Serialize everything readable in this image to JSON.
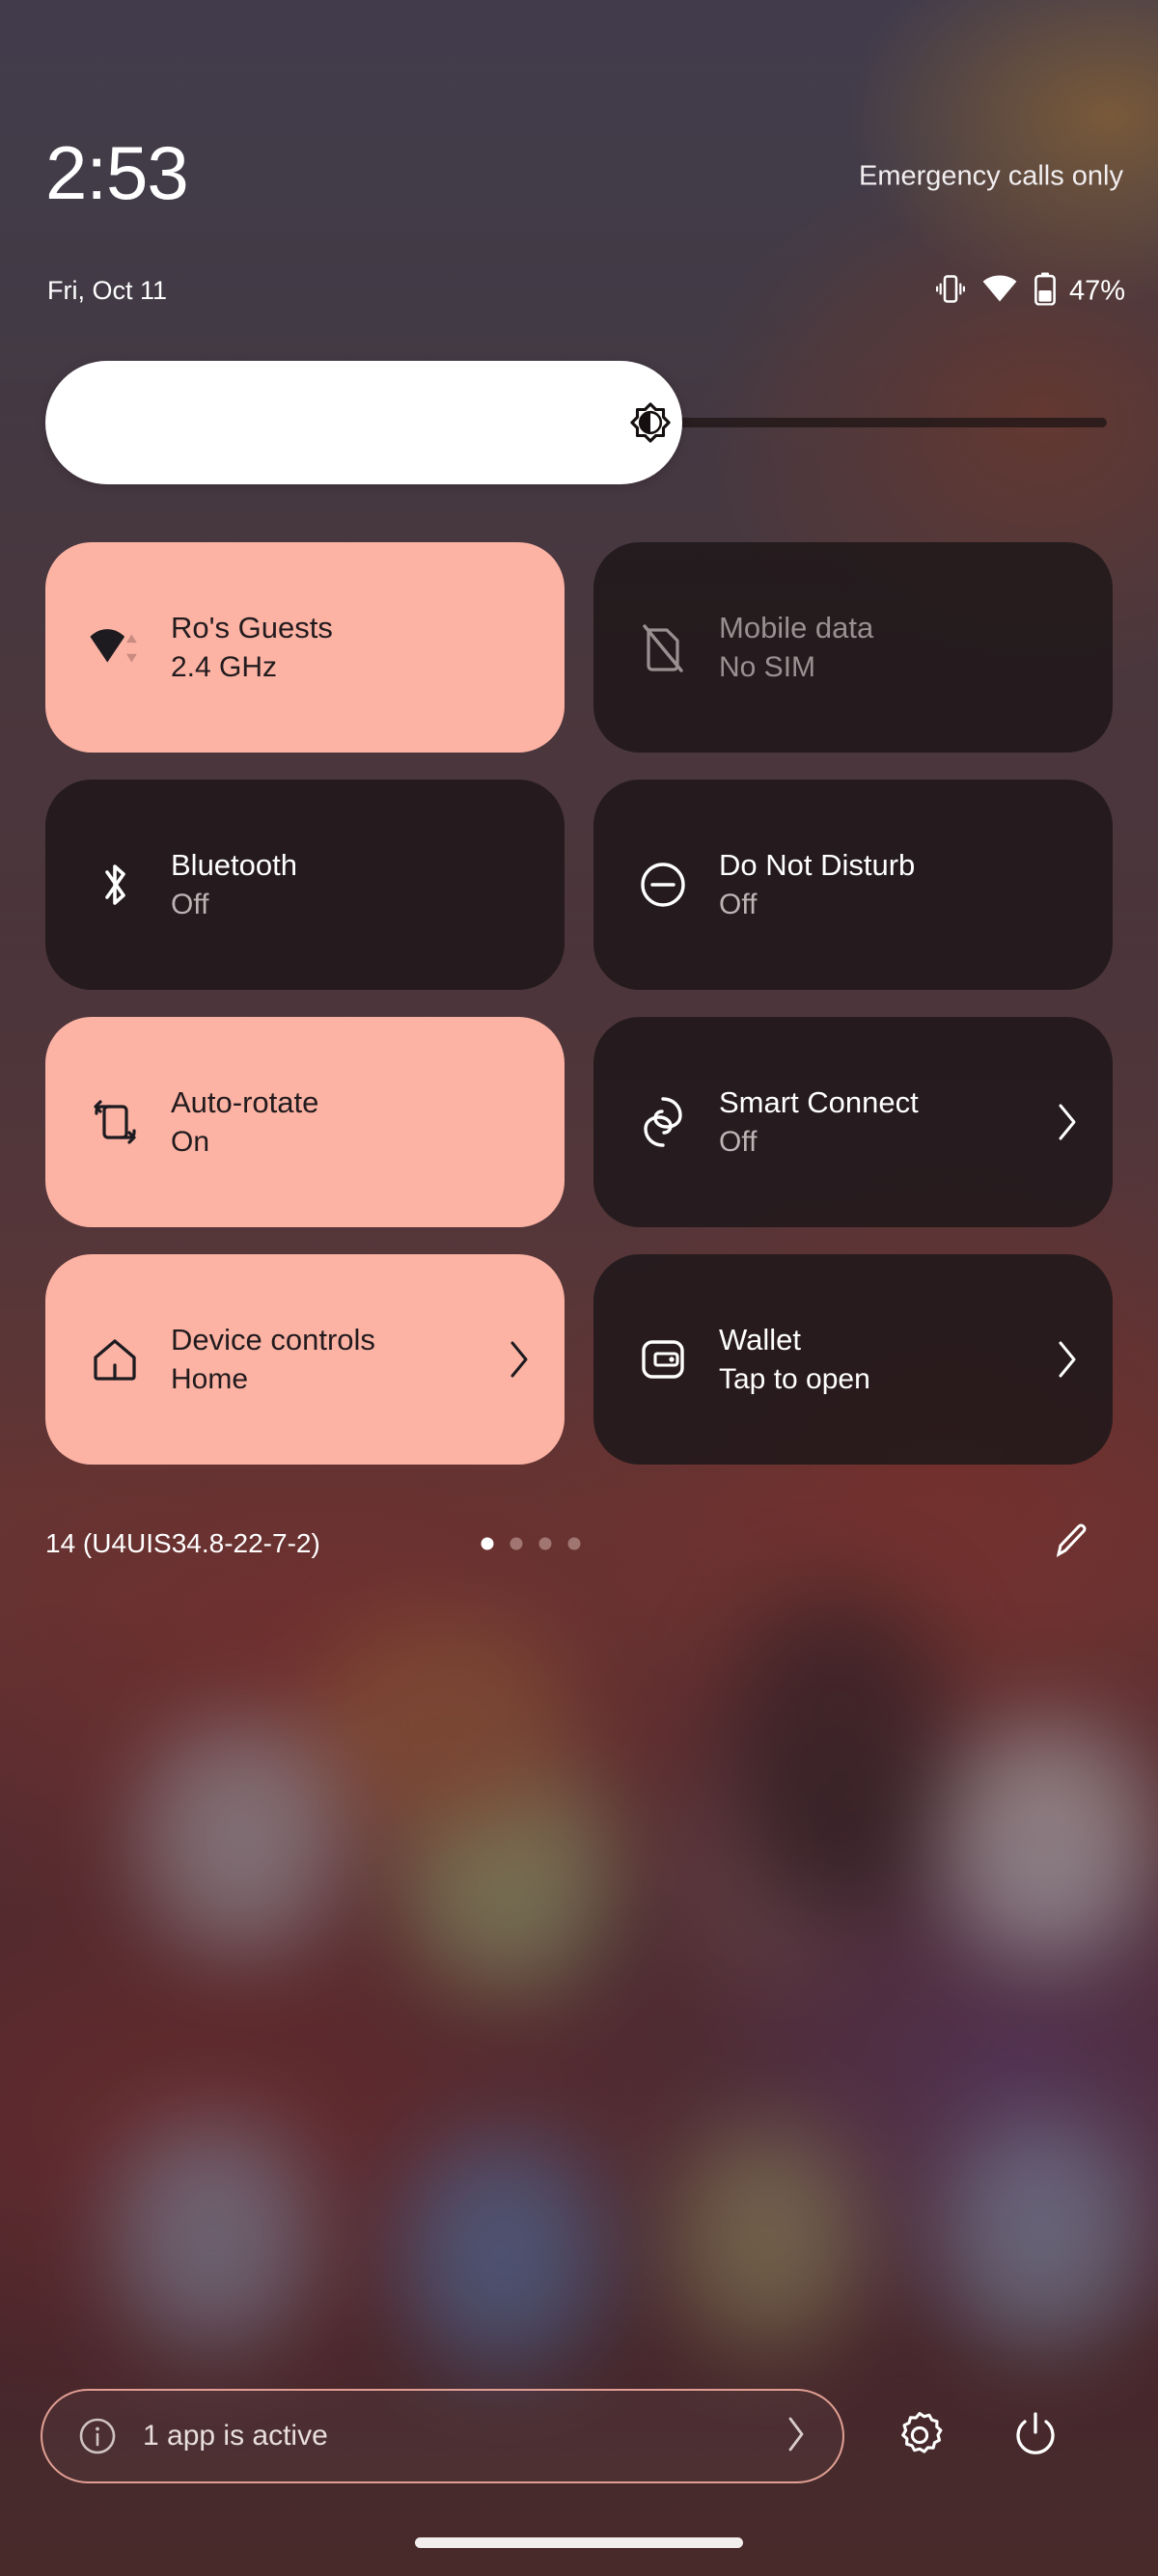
{
  "status_bar": {
    "clock": "2:53",
    "date": "Fri, Oct 11",
    "carrier": "Emergency calls only",
    "battery_percent": "47%",
    "icons": [
      "vibrate-icon",
      "wifi-icon",
      "battery-icon"
    ]
  },
  "brightness": {
    "name": "brightness-slider",
    "icon": "brightness-auto-icon",
    "fill_percent": 60
  },
  "tiles": [
    {
      "id": "wifi",
      "title": "Ro's Guests",
      "subtitle": "2.4 GHz",
      "state": "on",
      "icon": "wifi-icon",
      "chevron": false,
      "dim": false
    },
    {
      "id": "mobile-data",
      "title": "Mobile data",
      "subtitle": "No SIM",
      "state": "off",
      "icon": "sim-off-icon",
      "chevron": false,
      "dim": true
    },
    {
      "id": "bluetooth",
      "title": "Bluetooth",
      "subtitle": "Off",
      "state": "off",
      "icon": "bluetooth-icon",
      "chevron": false,
      "dim": false
    },
    {
      "id": "do-not-disturb",
      "title": "Do Not Disturb",
      "subtitle": "Off",
      "state": "off",
      "icon": "do-not-disturb-icon",
      "chevron": false,
      "dim": false
    },
    {
      "id": "auto-rotate",
      "title": "Auto-rotate",
      "subtitle": "On",
      "state": "on",
      "icon": "auto-rotate-icon",
      "chevron": false,
      "dim": false
    },
    {
      "id": "smart-connect",
      "title": "Smart Connect",
      "subtitle": "Off",
      "state": "off",
      "icon": "smart-connect-icon",
      "chevron": true,
      "dim": false
    },
    {
      "id": "device-controls",
      "title": "Device controls",
      "subtitle": "Home",
      "state": "on",
      "icon": "home-icon",
      "chevron": true,
      "dim": false
    },
    {
      "id": "wallet",
      "title": "Wallet",
      "subtitle": "Tap to open",
      "state": "off",
      "icon": "wallet-icon",
      "chevron": true,
      "dim": false,
      "bright_sub": true
    }
  ],
  "qs_footer": {
    "build": "14 (U4UIS34.8-22-7-2)",
    "page_count": 4,
    "active_page": 1,
    "edit_icon": "pencil-icon"
  },
  "bottom_bar": {
    "active_apps_text": "1 app is active",
    "info_icon": "info-icon",
    "chevron_icon": "chevron-right-icon",
    "settings_icon": "gear-icon",
    "power_icon": "power-icon"
  },
  "colors": {
    "tile_on": "#fcb3a4",
    "tile_off": "#201a1a",
    "accent_border": "#fcb3a4",
    "text_primary": "#ffffff",
    "text_secondary": "#bdb3b4",
    "text_on_tile": "#221b1e"
  }
}
